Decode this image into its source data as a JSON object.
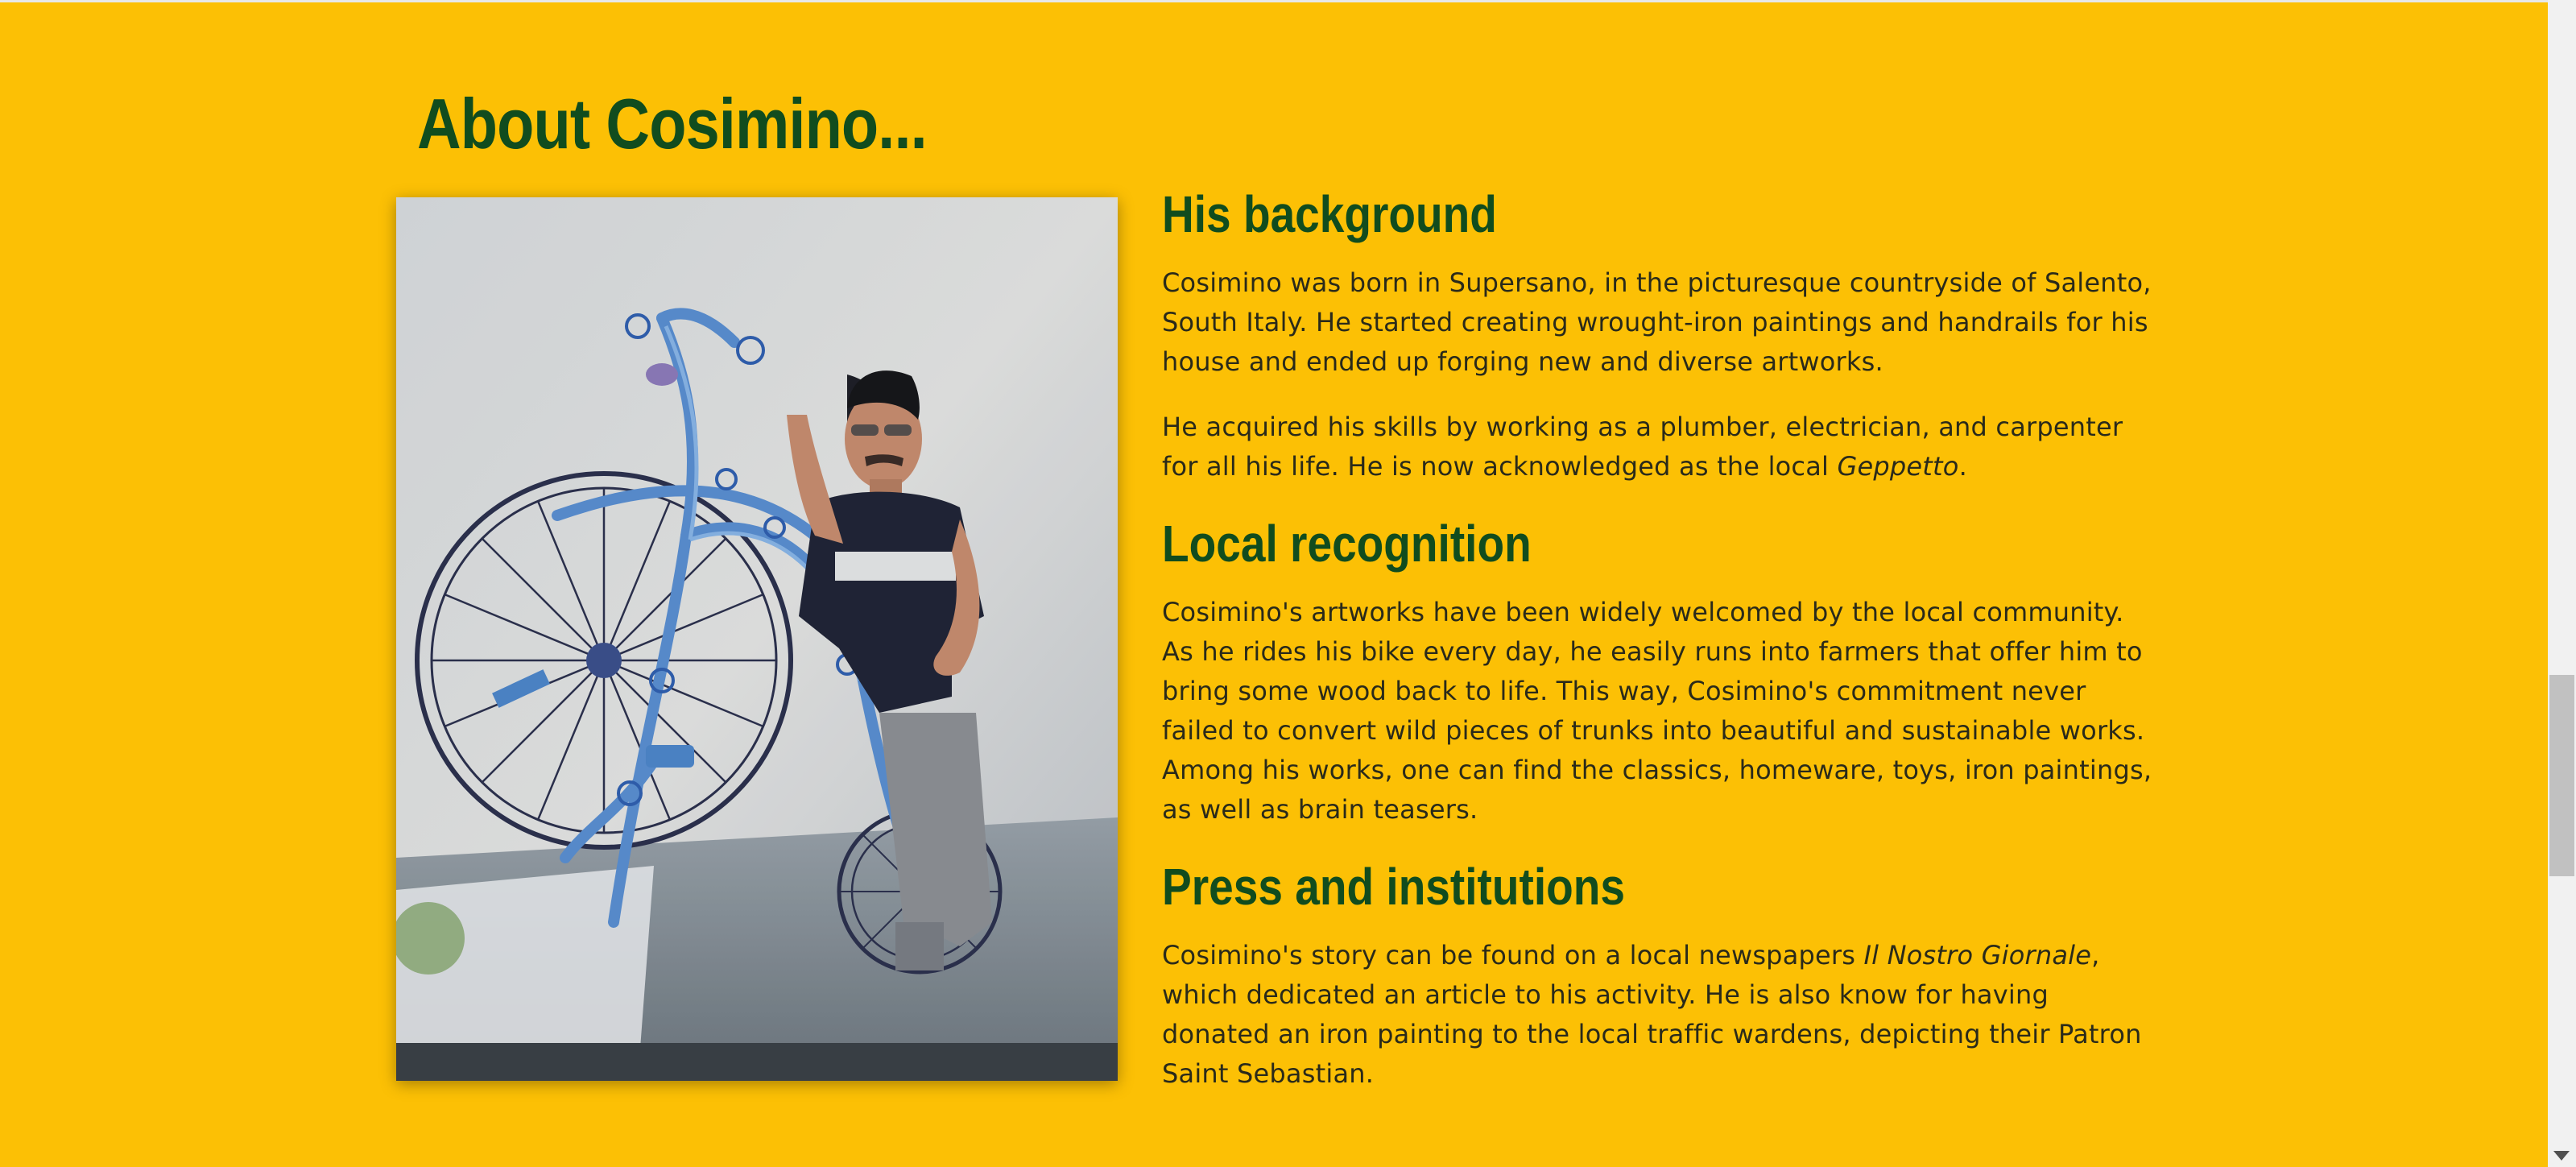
{
  "about": {
    "title": "About Cosimino...",
    "photo_alt": "Cosimino standing next to his wrought-iron penny-farthing bicycle sculpture"
  },
  "sections": {
    "background": {
      "heading": "His background",
      "p1": "Cosimino was born in Supersano, in the picturesque countryside of Salento, South Italy. He started creating wrought-iron paintings and handrails for his house and ended up forging new and diverse artworks.",
      "p2_before": "He acquired his skills by working as a plumber, electrician, and carpenter for all his life. He is now acknowledged as the local ",
      "p2_em": "Geppetto",
      "p2_after": "."
    },
    "recognition": {
      "heading": "Local recognition",
      "p1": "Cosimino's artworks have been widely welcomed by the local community. As he rides his bike every day, he easily runs into farmers that offer him to bring some wood back to life. This way, Cosimino's commitment never failed to convert wild pieces of trunks into beautiful and sustainable works. Among his works, one can find the classics, homeware, toys, iron paintings, as well as brain teasers."
    },
    "press": {
      "heading": "Press and institutions",
      "p1_before": "Cosimino's story can be found on a local newspapers ",
      "p1_em": "Il Nostro Giornale",
      "p1_after": ", which dedicated an article to his activity. He is also know for having donated an iron painting to the local traffic wardens, depicting their Patron Saint Sebastian."
    }
  },
  "colors": {
    "background": "#FCC005",
    "heading": "#114C1E",
    "body_text": "#2a2a1a"
  }
}
